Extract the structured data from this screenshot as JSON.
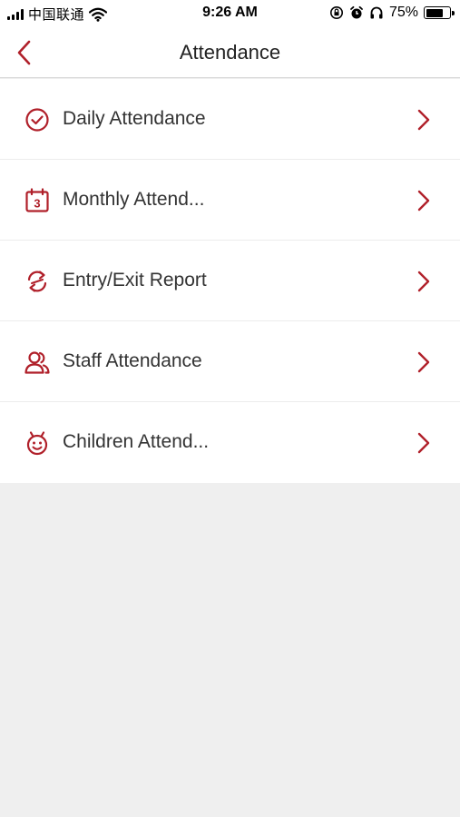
{
  "status_bar": {
    "carrier": "中国联通",
    "time": "9:26 AM",
    "battery_percent": "75%",
    "battery_level": 0.75
  },
  "nav": {
    "title": "Attendance",
    "back_icon": "chevron-left-icon"
  },
  "colors": {
    "accent": "#b0202a",
    "background": "#efefef",
    "card": "#ffffff"
  },
  "menu": {
    "items": [
      {
        "label": "Daily Attendance",
        "icon": "check-circle-icon"
      },
      {
        "label": "Monthly Attend...",
        "icon": "calendar-icon",
        "icon_text": "3"
      },
      {
        "label": "Entry/Exit Report",
        "icon": "swap-arrows-icon"
      },
      {
        "label": "Staff Attendance",
        "icon": "people-icon"
      },
      {
        "label": "Children Attend...",
        "icon": "child-face-icon"
      }
    ]
  }
}
